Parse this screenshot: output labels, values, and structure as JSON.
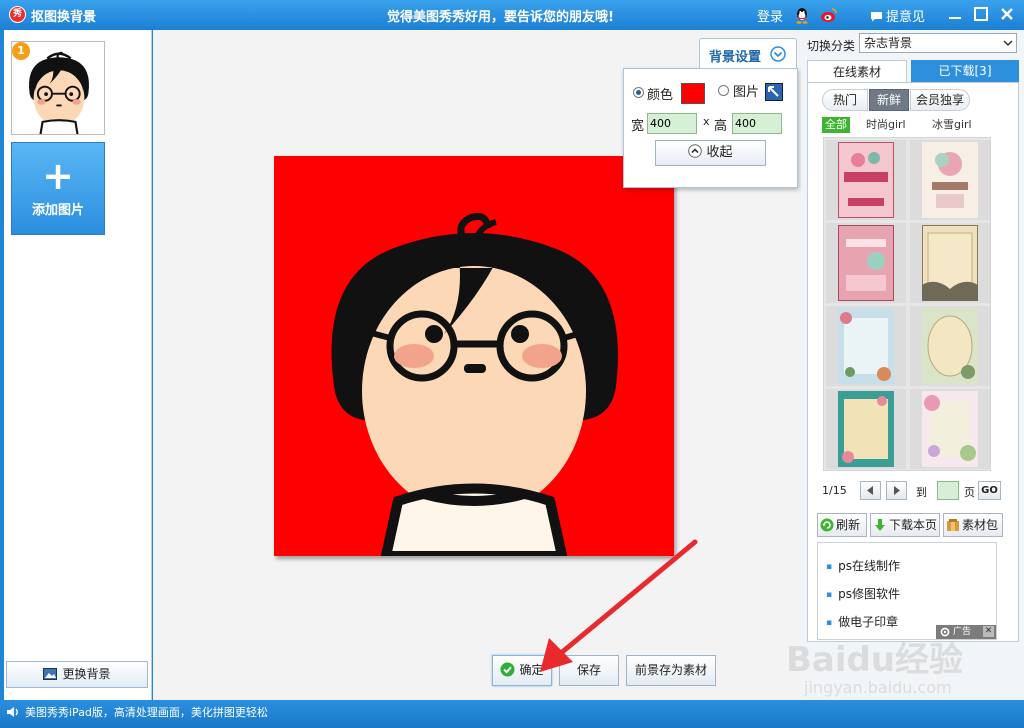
{
  "titlebar": {
    "logo": "秀",
    "title": "抠图换背景",
    "slogan": "觉得美图秀秀好用，要告诉您的朋友哦!",
    "login": "登录",
    "feedback": "提意见"
  },
  "left": {
    "thumb_badge": "1",
    "add_plus": "+",
    "add_label": "添加图片",
    "change_bg": "更换背景"
  },
  "bg_settings": {
    "tab_label": "背景设置",
    "color_label": "颜色",
    "picture_label": "图片",
    "width_label": "宽",
    "width_value": "400",
    "times": "x",
    "height_label": "高",
    "height_value": "400",
    "collapse_label": "收起",
    "mode_selected": "color",
    "color": "#ff0000"
  },
  "bottom": {
    "ok": "确定",
    "save": "保存",
    "save_as": "前景存为素材"
  },
  "right": {
    "switch_label": "切换分类",
    "category_value": "杂志背景",
    "tab_online": "在线素材",
    "tab_downloaded": "已下载[3]",
    "subtab_hot": "热门",
    "subtab_new": "新鲜",
    "subtab_vip": "会员独享",
    "filter_all": "全部",
    "filter_fashion": "时尚girl",
    "filter_ice": "冰雪girl",
    "page_current": "1/15",
    "page_to": "到",
    "page_unit": "页",
    "go": "GO",
    "refresh": "刷新",
    "download_page": "下载本页",
    "material_pack": "素材包",
    "ads": [
      "ps在线制作",
      "ps修图软件",
      "做电子印章"
    ],
    "ad_tag": "广告",
    "ad_close": "✕"
  },
  "status": {
    "text": "美图秀秀iPad版，高清处理画面，美化拼图更轻松"
  },
  "watermark": {
    "main": "Baidu经验",
    "sub": "jingyan.baidu.com"
  },
  "colors": {
    "accent": "#2e8fdc",
    "canvas_bg": "#ff0000",
    "arrow": "#e8292e"
  }
}
